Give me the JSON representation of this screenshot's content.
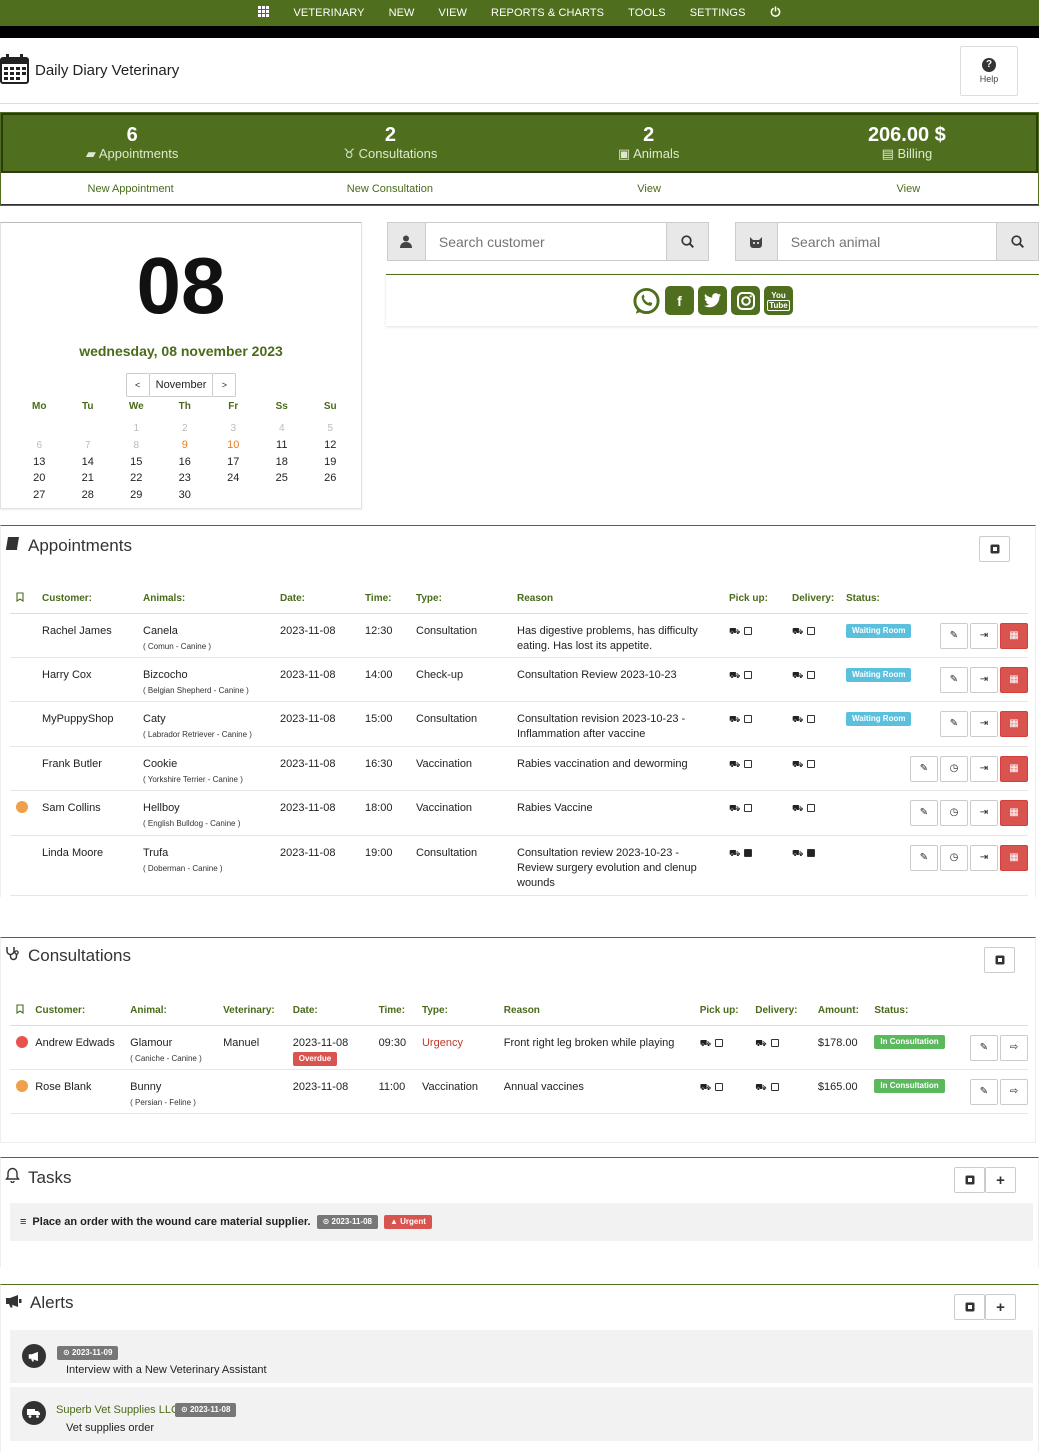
{
  "nav": {
    "menu_icon": "grid-icon",
    "items": [
      "VETERINARY",
      "NEW",
      "VIEW",
      "REPORTS & CHARTS",
      "TOOLS",
      "SETTINGS"
    ],
    "power_icon": "power-icon"
  },
  "header": {
    "title": "Daily Diary Veterinary",
    "help_label": "Help"
  },
  "stats": [
    {
      "value": "6",
      "label": "Appointments",
      "action": "New Appointment"
    },
    {
      "value": "2",
      "label": "Consultations",
      "action": "New Consultation"
    },
    {
      "value": "2",
      "label": "Animals",
      "action": "View"
    },
    {
      "value": "206.00 $",
      "label": "Billing",
      "action": "View"
    }
  ],
  "calendar": {
    "day": "08",
    "long_date": "wednesday, 08 november 2023",
    "month": "November",
    "prev": "<",
    "next": ">",
    "weekdays": [
      "Mo",
      "Tu",
      "We",
      "Th",
      "Fr",
      "Ss",
      "Su"
    ],
    "weeks": [
      [
        "",
        "",
        "1",
        "2",
        "3",
        "4",
        "5"
      ],
      [
        "6",
        "7",
        "8",
        "9",
        "10",
        "11",
        "12"
      ],
      [
        "13",
        "14",
        "15",
        "16",
        "17",
        "18",
        "19"
      ],
      [
        "20",
        "21",
        "22",
        "23",
        "24",
        "25",
        "26"
      ],
      [
        "27",
        "28",
        "29",
        "30",
        "",
        "",
        ""
      ]
    ]
  },
  "search": {
    "customer_placeholder": "Search customer",
    "animal_placeholder": "Search animal"
  },
  "social": [
    "whatsapp-icon",
    "facebook-icon",
    "twitter-icon",
    "instagram-icon",
    "youtube-icon"
  ],
  "appointments": {
    "title": "Appointments",
    "headers": [
      "Customer:",
      "Animals:",
      "Date:",
      "Time:",
      "Type:",
      "Reason",
      "Pick up:",
      "Delivery:",
      "Status:"
    ],
    "rows": [
      {
        "customer": "Rachel James",
        "animal": "Canela",
        "breed": "( Comun - Canine )",
        "date": "2023-11-08",
        "time": "12:30",
        "type": "Consultation",
        "reason": "Has digestive problems, has difficulty eating. Has lost its appetite.",
        "status": "Waiting Room",
        "pickup": false,
        "delivery": false,
        "dot": ""
      },
      {
        "customer": "Harry Cox",
        "animal": "Bizcocho",
        "breed": "( Belgian Shepherd - Canine )",
        "date": "2023-11-08",
        "time": "14:00",
        "type": "Check-up",
        "reason": "Consultation Review 2023-10-23",
        "status": "Waiting Room",
        "pickup": false,
        "delivery": false,
        "dot": ""
      },
      {
        "customer": "MyPuppyShop",
        "animal": "Caty",
        "breed": "( Labrador Retriever - Canine )",
        "date": "2023-11-08",
        "time": "15:00",
        "type": "Consultation",
        "reason": "Consultation revision 2023-10-23 - Inflammation after vaccine",
        "status": "Waiting Room",
        "pickup": false,
        "delivery": false,
        "dot": ""
      },
      {
        "customer": "Frank Butler",
        "animal": "Cookie",
        "breed": "( Yorkshire Terrier - Canine )",
        "date": "2023-11-08",
        "time": "16:30",
        "type": "Vaccination",
        "reason": "Rabies vaccination and deworming",
        "status": "",
        "pickup": false,
        "delivery": false,
        "dot": ""
      },
      {
        "customer": "Sam Collins",
        "animal": "Hellboy",
        "breed": "( English Bulldog - Canine )",
        "date": "2023-11-08",
        "time": "18:00",
        "type": "Vaccination",
        "reason": "Rabies Vaccine",
        "status": "",
        "pickup": false,
        "delivery": false,
        "dot": "#f0a04b"
      },
      {
        "customer": "Linda Moore",
        "animal": "Trufa",
        "breed": "( Doberman - Canine )",
        "date": "2023-11-08",
        "time": "19:00",
        "type": "Consultation",
        "reason": "Consultation review 2023-10-23 - Review surgery evolution and clenup wounds",
        "status": "",
        "pickup": true,
        "delivery": true,
        "dot": ""
      }
    ]
  },
  "consultations": {
    "title": "Consultations",
    "headers": [
      "Customer:",
      "Animal:",
      "Veterinary:",
      "Date:",
      "Time:",
      "Type:",
      "Reason",
      "Pick up:",
      "Delivery:",
      "Amount:",
      "Status:"
    ],
    "rows": [
      {
        "customer": "Andrew Edwads",
        "animal": "Glamour",
        "breed": "( Caniche - Canine )",
        "vet": "Manuel",
        "date": "2023-11-08",
        "overdue": "Overdue",
        "time": "09:30",
        "type": "Urgency",
        "reason": "Front right leg broken while playing",
        "amount": "$178.00",
        "status": "In Consultation",
        "dot": "#e9534f"
      },
      {
        "customer": "Rose Blank",
        "animal": "Bunny",
        "breed": "( Persian - Feline )",
        "vet": "",
        "date": "2023-11-08",
        "overdue": "",
        "time": "11:00",
        "type": "Vaccination",
        "reason": "Annual vaccines",
        "amount": "$165.00",
        "status": "In Consultation",
        "dot": "#f0a04b"
      }
    ]
  },
  "tasks": {
    "title": "Tasks",
    "items": [
      {
        "text": "Place an order with the wound care material supplier.",
        "date": "2023-11-08",
        "priority": "Urgent"
      }
    ]
  },
  "alerts": {
    "title": "Alerts",
    "items": [
      {
        "sender": "",
        "date": "2023-11-09",
        "text": "Interview with a New Veterinary Assistant",
        "icon": "megaphone-icon"
      },
      {
        "sender": "Superb Vet Supplies LLC",
        "date": "2023-11-08",
        "text": "Vet supplies order",
        "icon": "truck-icon"
      }
    ]
  },
  "colors": {
    "brand": "#4f6f1f",
    "waiting": "#5bc0de",
    "in_consultation": "#5cb85c",
    "danger": "#d9534f",
    "highlight_day": "#e67e22"
  }
}
